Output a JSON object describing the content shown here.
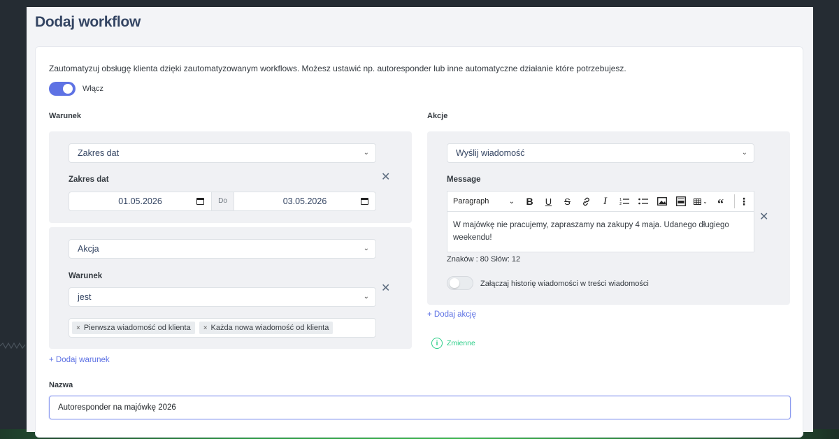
{
  "page": {
    "title": "Dodaj workflow",
    "description": "Zautomatyzuj obsługę klienta dzięki zautomatyzowanym workflows. Możesz ustawić np. autoresponder lub inne automatyczne działanie które potrzebujesz.",
    "enable_toggle": {
      "label": "Włącz",
      "on": true
    }
  },
  "conditions": {
    "section_label": "Warunek",
    "block1": {
      "type_select": "Zakres dat",
      "field_label": "Zakres dat",
      "date_from": "01.05.2026",
      "date_sep": "Do",
      "date_to": "03.05.2026"
    },
    "block2": {
      "type_select": "Akcja",
      "field_label": "Warunek",
      "operator_select": "jest",
      "tags": [
        "Pierwsza wiadomość od klienta",
        "Każda nowa wiadomość od klienta"
      ]
    },
    "add_link": "+ Dodaj warunek"
  },
  "actions": {
    "section_label": "Akcje",
    "action_select": "Wyślij wiadomość",
    "message_label": "Message",
    "editor": {
      "paragraph_select": "Paragraph",
      "content": "W majówkę nie pracujemy, zapraszamy na zakupy 4 maja. Udanego długiego weekendu!"
    },
    "counter": "Znaków : 80 Słów: 12",
    "attach_toggle": {
      "label": "Załączaj historię wiadomości w treści wiadomości",
      "on": false
    },
    "add_link": "+ Dodaj akcję",
    "variables_link": "Zmienne"
  },
  "name_field": {
    "label": "Nazwa",
    "value": "Autoresponder na majówkę 2026"
  },
  "colors": {
    "accent": "#5e72e4",
    "success": "#2dce89",
    "title": "#344563"
  }
}
